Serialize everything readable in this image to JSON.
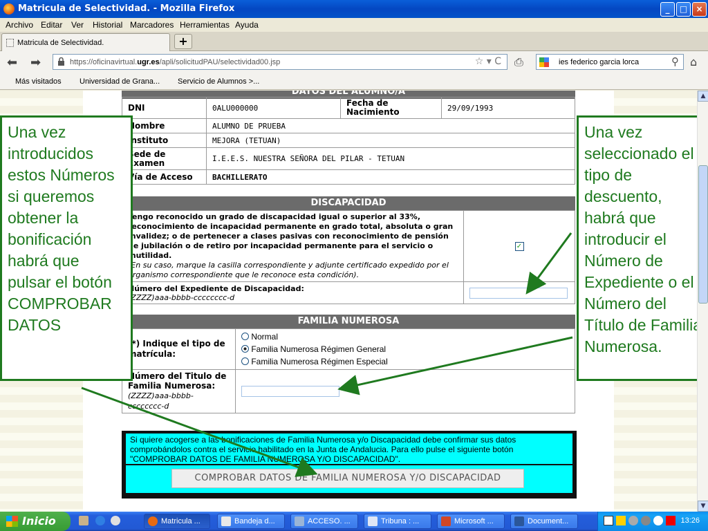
{
  "window": {
    "title": "Matricula de Selectividad. - Mozilla Firefox",
    "min": "_",
    "max": "□",
    "close": "×"
  },
  "menu": [
    "Archivo",
    "Editar",
    "Ver",
    "Historial",
    "Marcadores",
    "Herramientas",
    "Ayuda"
  ],
  "tab": {
    "label": "Matricula de Selectividad.",
    "new_tab": "+"
  },
  "nav": {
    "url_prefix": "https://oficinavirtual.",
    "url_domain": "ugr.es",
    "url_path": "/apli/solicitudPAU/selectividad00.jsp",
    "url_icons": "☆ ▾ C",
    "search": "ies federico garcia lorca"
  },
  "bookmarks": [
    "Más visitados",
    "Universidad de Grana...",
    "Servicio de Alumnos >..."
  ],
  "alumno": {
    "header": "DATOS DEL ALUMNO/A",
    "dni_label": "DNI",
    "dni": "0ALU000000",
    "fecha_label": "Fecha de Nacimiento",
    "fecha": "29/09/1993",
    "nombre_label": "Nombre",
    "nombre": "ALUMNO DE PRUEBA",
    "instituto_label": "Instituto",
    "instituto": "MEJORA (TETUAN)",
    "sede_label": "Sede de Examen",
    "sede": "I.E.E.S. NUESTRA SEÑORA DEL PILAR - TETUAN",
    "via_label": "Vía de Acceso",
    "via": "BACHILLERATO"
  },
  "discapacidad": {
    "header": "DISCAPACIDAD",
    "text": "Tengo reconocido un grado de discapacidad igual o superior al 33%, reconocimiento de incapacidad permanente en grado total, absoluta o gran invalidez; o de pertenecer a clases pasivas con reconocimiento de pensión de jubilación o de retiro por incapacidad permanente para el servicio o inutilidad.",
    "note": "(En su caso, marque la casilla correspondiente y adjunte certificado expedido por el organismo correspondiente que le reconoce esta condición).",
    "checkmark": "✓",
    "exp_label": "Número del Expediente de Discapacidad:",
    "exp_format": "(ZZZZ)aaa-bbbb-cccccccc-d"
  },
  "familia": {
    "header": "FAMILIA NUMEROSA",
    "tipo_label": "(*) Indique el tipo de matrícula:",
    "options": [
      "Normal",
      "Familia Numerosa Régimen General",
      "Familia Numerosa Régimen Especial"
    ],
    "selected": "Familia Numerosa Régimen General",
    "titulo_label": "Número del Titulo de Familia Numerosa:",
    "titulo_format": "(ZZZZ)aaa-bbbb-cccccccc-d"
  },
  "confirm": {
    "text": "Si quiere acogerse a las bonificaciones de Familia Numerosa y/o Discapacidad debe confirmar sus datos comprobándolos contra el servicio habilitado en la Junta de Andalucia. Para ello pulse el siguiente botón \"COMPROBAR DATOS DE FAMILIA NUMEROSA Y/O DISCAPACIDAD\".",
    "button": "COMPROBAR DATOS DE FAMILIA NUMEROSA Y/O DISCAPACIDAD"
  },
  "callouts": {
    "left": "Una vez introducidos estos Números si queremos obtener la bonificación habrá que pulsar el botón COMPROBAR DATOS",
    "right": "Una vez seleccionado el tipo de descuento, habrá que introducir el Número de Expediente o el Número del Título de Familia Numerosa."
  },
  "taskbar": {
    "start": "Inicio",
    "items": [
      "Matricula ...",
      "Bandeja d...",
      "ACCESO. ...",
      "Tribuna : ...",
      "Microsoft ...",
      "Document..."
    ],
    "clock": "13:26"
  },
  "colors": {
    "accent_green": "#1f7a1f",
    "section_gray": "#6b6b6b",
    "confirm_cyan": "#00ffff"
  }
}
